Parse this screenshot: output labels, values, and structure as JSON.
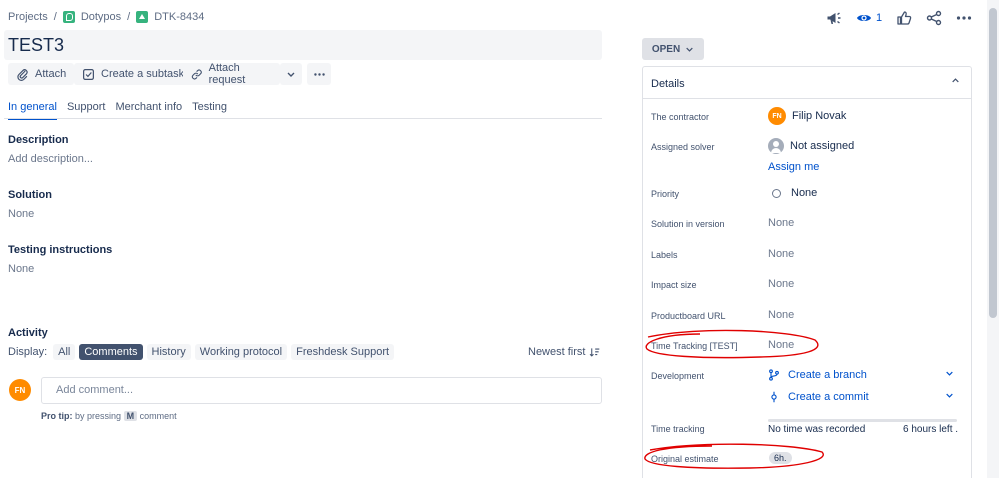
{
  "breadcrumb": {
    "projects": "Projects",
    "project": "Dotypos",
    "issue": "DTK-8434",
    "sep": "/"
  },
  "title": "TEST3",
  "toolbar": {
    "attach": "Attach",
    "subtask": "Create a subtask",
    "request": "Attach request"
  },
  "tabs": [
    "In general",
    "Support",
    "Merchant info",
    "Testing"
  ],
  "sections": {
    "description": {
      "label": "Description",
      "value": "Add description..."
    },
    "solution": {
      "label": "Solution",
      "value": "None"
    },
    "testing": {
      "label": "Testing instructions",
      "value": "None"
    }
  },
  "activity": {
    "label": "Activity",
    "display_label": "Display:",
    "filters": [
      "All",
      "Comments",
      "History",
      "Working protocol",
      "Freshdesk Support"
    ],
    "sort": "Newest first",
    "avatar": "FN",
    "comment_placeholder": "Add comment...",
    "protip_bold": "Pro tip:",
    "protip_text": "by pressing",
    "protip_key": "M",
    "protip_end": "comment"
  },
  "header": {
    "watch_count": "1"
  },
  "status": "OPEN",
  "details": {
    "title": "Details",
    "contractor": {
      "label": "The contractor",
      "avatar": "FN",
      "value": "Filip Novak"
    },
    "solver": {
      "label": "Assigned solver",
      "value": "Not assigned",
      "assign_me": "Assign me"
    },
    "priority": {
      "label": "Priority",
      "value": "None"
    },
    "solution_version": {
      "label": "Solution in version",
      "value": "None"
    },
    "labels": {
      "label": "Labels",
      "value": "None"
    },
    "impact": {
      "label": "Impact size",
      "value": "None"
    },
    "productboard": {
      "label": "Productboard URL",
      "value": "None"
    },
    "time_tracking_test": {
      "label": "Time Tracking [TEST]",
      "value": "None"
    },
    "development": {
      "label": "Development",
      "branch": "Create a branch",
      "commit": "Create a commit"
    },
    "time_tracking": {
      "label": "Time tracking",
      "recorded": "No time was recorded",
      "left": "6 hours left ."
    },
    "original_estimate": {
      "label": "Original estimate",
      "value": "6h."
    }
  },
  "colors": {
    "accent": "#0052cc",
    "annotation": "#e00000",
    "avatar": "#ff8b00"
  }
}
